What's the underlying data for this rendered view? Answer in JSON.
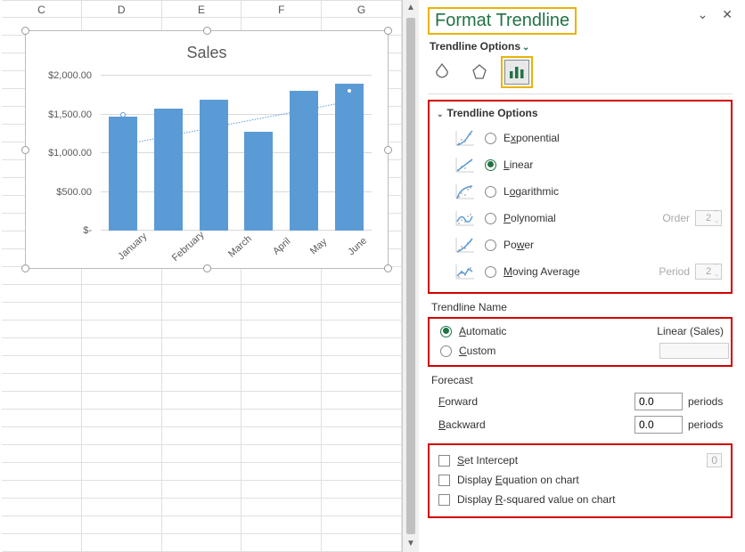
{
  "columns": [
    "C",
    "D",
    "E",
    "F",
    "G"
  ],
  "panel": {
    "title": "Format Trendline",
    "sub_menu": "Trendline Options",
    "section_title": "Trendline Options",
    "options": [
      {
        "key": "exponential",
        "label": "Exponential",
        "u": "x",
        "selected": false
      },
      {
        "key": "linear",
        "label": "Linear",
        "u": "L",
        "selected": true
      },
      {
        "key": "logarithmic",
        "label": "Logarithmic",
        "u": "o",
        "selected": false
      },
      {
        "key": "polynomial",
        "label": "Polynomial",
        "u": "P",
        "selected": false,
        "extra_label": "Order",
        "extra_value": "2"
      },
      {
        "key": "power",
        "label": "Power",
        "u": "w",
        "selected": false
      },
      {
        "key": "moving",
        "label": "Moving Average",
        "u": "M",
        "selected": false,
        "extra_label": "Period",
        "extra_value": "2"
      }
    ],
    "name_section": "Trendline Name",
    "name_auto": "Automatic",
    "name_auto_value": "Linear (Sales)",
    "name_custom": "Custom",
    "forecast_section": "Forecast",
    "forward_label": "Forward",
    "forward_value": "0.0",
    "backward_label": "Backward",
    "backward_value": "0.0",
    "periods_label": "periods",
    "set_intercept": "Set Intercept",
    "set_intercept_value": "0",
    "display_eq": "Display Equation on chart",
    "display_r2": "Display R-squared value on chart"
  },
  "chart_data": {
    "type": "bar",
    "title": "Sales",
    "categories": [
      "January",
      "February",
      "March",
      "April",
      "May",
      "June"
    ],
    "values": [
      1470,
      1580,
      1690,
      1280,
      1800,
      1900
    ],
    "ylim": [
      0,
      2000
    ],
    "y_ticks": [
      "$-",
      "$500.00",
      "$1,000.00",
      "$1,500.00",
      "$2,000.00"
    ],
    "trendline": {
      "type": "linear",
      "start": 1490,
      "end": 1810
    }
  }
}
